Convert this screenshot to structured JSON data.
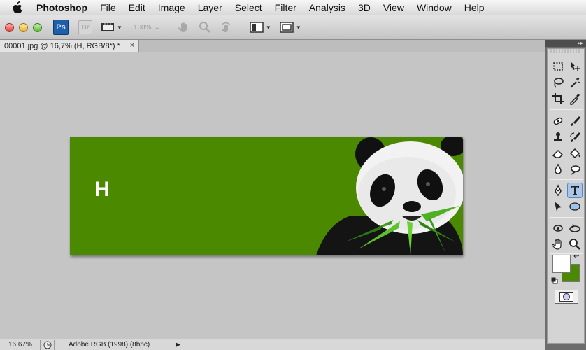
{
  "menubar": {
    "app_name": "Photoshop",
    "items": [
      "File",
      "Edit",
      "Image",
      "Layer",
      "Select",
      "Filter",
      "Analysis",
      "3D",
      "View",
      "Window",
      "Help"
    ]
  },
  "appbar": {
    "ps_logo": "Ps",
    "br_logo": "Br",
    "zoom_value": "100%"
  },
  "document": {
    "tab_title": "00001.jpg @ 16,7% (H, RGB/8*) *",
    "close_glyph": "×",
    "text_layer_content": "H",
    "canvas_color": "#4b8a00"
  },
  "statusbar": {
    "zoom": "16,67%",
    "profile": "Adobe RGB (1998) (8bpc)",
    "arrow": "▶"
  },
  "tools": {
    "collapse_glyph": "▸▸",
    "active_tool": "type-tool",
    "foreground_color": "#ffffff",
    "background_color": "#4b8a00",
    "swap_glyph": "↩"
  }
}
